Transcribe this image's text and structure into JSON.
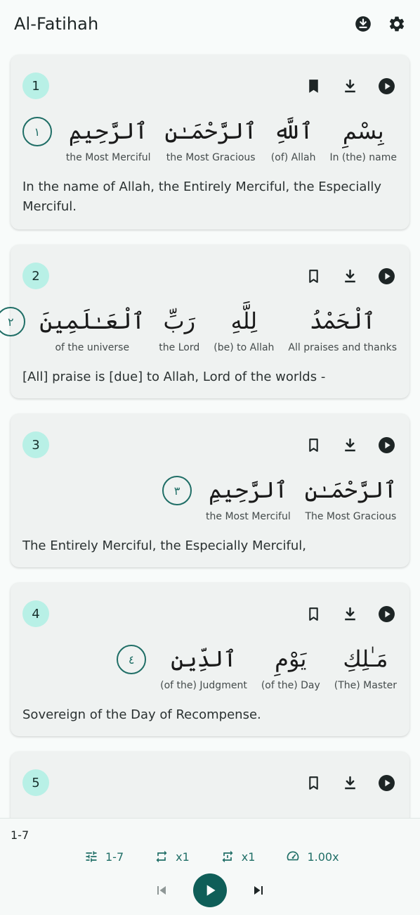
{
  "appbar": {
    "title": "Al-Fatihah",
    "actions": [
      {
        "icon": "download-circle-icon"
      },
      {
        "icon": "gear-icon"
      }
    ]
  },
  "colors": {
    "accent": "#1f6e66",
    "badge": "#b8f0e6",
    "card": "#eff2f1",
    "play_button": "#0f5e58"
  },
  "verses": [
    {
      "number": "1",
      "bookmarked": true,
      "words": [
        {
          "arabic": "بِسْمِ",
          "gloss": "In (the) name"
        },
        {
          "arabic": "ٱللَّهِ",
          "gloss": "(of) Allah"
        },
        {
          "arabic": "ٱلرَّحْمَـٰنِ",
          "gloss": "the Most Gracious"
        },
        {
          "arabic": "ٱلرَّحِيمِ",
          "gloss": "the Most Merciful"
        }
      ],
      "marker": "١",
      "translation": "In the name of Allah, the Entirely Merciful, the Especially Merciful."
    },
    {
      "number": "2",
      "bookmarked": false,
      "words": [
        {
          "arabic": "ٱلْحَمْدُ",
          "gloss": "All praises and thanks"
        },
        {
          "arabic": "لِلَّهِ",
          "gloss": "(be) to Allah"
        },
        {
          "arabic": "رَبِّ",
          "gloss": "the Lord"
        },
        {
          "arabic": "ٱلْعَـٰلَمِينَ",
          "gloss": "of the universe"
        }
      ],
      "marker": "٢",
      "translation": "[All] praise is [due] to Allah, Lord of the worlds -"
    },
    {
      "number": "3",
      "bookmarked": false,
      "words": [
        {
          "arabic": "ٱلرَّحْمَـٰنِ",
          "gloss": "The Most Gracious"
        },
        {
          "arabic": "ٱلرَّحِيمِ",
          "gloss": "the Most Merciful"
        }
      ],
      "marker": "٣",
      "translation": "The Entirely Merciful, the Especially Merciful,"
    },
    {
      "number": "4",
      "bookmarked": false,
      "words": [
        {
          "arabic": "مَـٰلِكِ",
          "gloss": "(The) Master"
        },
        {
          "arabic": "يَوْمِ",
          "gloss": "(of the) Day"
        },
        {
          "arabic": "ٱلدِّينِ",
          "gloss": "(of the) Judgment"
        }
      ],
      "marker": "٤",
      "translation": "Sovereign of the Day of Recompense."
    },
    {
      "number": "5",
      "bookmarked": false
    }
  ],
  "player": {
    "range_label": "1-7",
    "controls": [
      {
        "icon": "tune-icon",
        "label": "1-7"
      },
      {
        "icon": "repeat-icon",
        "label": "x1"
      },
      {
        "icon": "repeat-verse-icon",
        "label": "x1"
      },
      {
        "icon": "speed-icon",
        "label": "1.00x"
      }
    ]
  }
}
